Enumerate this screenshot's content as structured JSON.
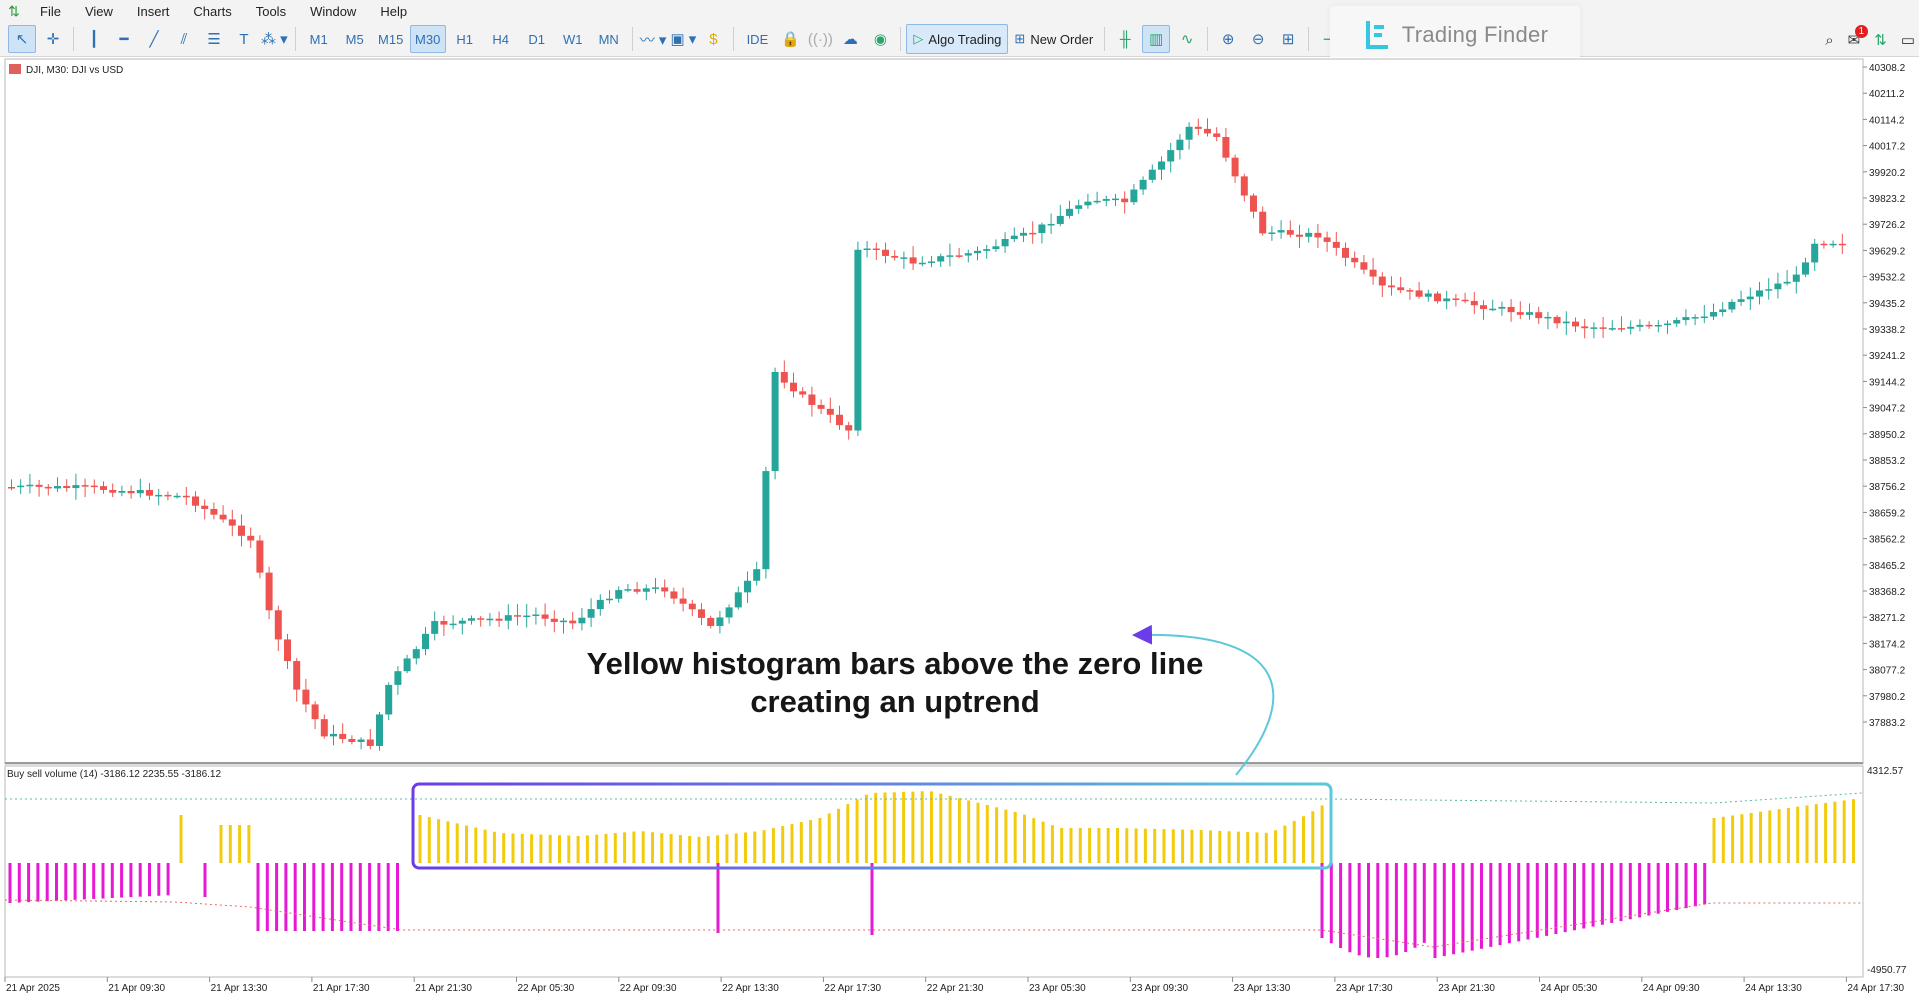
{
  "menu": [
    "File",
    "View",
    "Insert",
    "Charts",
    "Tools",
    "Window",
    "Help"
  ],
  "toolbar": {
    "timeframes": [
      "M1",
      "M5",
      "M15",
      "M30",
      "H1",
      "H4",
      "D1",
      "W1",
      "MN"
    ],
    "active_timeframe": "M30",
    "ide_label": "IDE",
    "algo_label": "Algo Trading",
    "order_label": "New Order"
  },
  "brand": {
    "name": "Trading Finder"
  },
  "notifications": {
    "count": "1"
  },
  "chart": {
    "symbol_label": "DJI, M30:  DJI vs USD",
    "price_ticks": [
      "40308.2",
      "40211.2",
      "40114.2",
      "40017.2",
      "39920.2",
      "39823.2",
      "39726.2",
      "39629.2",
      "39532.2",
      "39435.2",
      "39338.2",
      "39241.2",
      "39144.2",
      "39047.2",
      "38950.2",
      "38853.2",
      "38756.2",
      "38659.2",
      "38562.2",
      "38465.2",
      "38368.2",
      "38271.2",
      "38174.2",
      "38077.2",
      "37980.2",
      "37883.2"
    ],
    "time_ticks": [
      "21 Apr 2025",
      "21 Apr 09:30",
      "21 Apr 13:30",
      "21 Apr 17:30",
      "21 Apr 21:30",
      "22 Apr 05:30",
      "22 Apr 09:30",
      "22 Apr 13:30",
      "22 Apr 17:30",
      "22 Apr 21:30",
      "23 Apr 05:30",
      "23 Apr 09:30",
      "23 Apr 13:30",
      "23 Apr 17:30",
      "23 Apr 21:30",
      "24 Apr 05:30",
      "24 Apr 09:30",
      "24 Apr 13:30",
      "24 Apr 17:30"
    ],
    "colors": {
      "bull": "#26a69a",
      "bear": "#ef5350",
      "buy_bar": "#f2cc0c",
      "sell_bar": "#e619d4"
    }
  },
  "indicator": {
    "label": "Buy sell volume (14) -3186.12 2235.55 -3186.12",
    "max_label": "4312.57",
    "min_label": "-4950.77"
  },
  "annotation": {
    "line1": "Yellow histogram bars above the zero line",
    "line2": "creating an uptrend"
  }
}
